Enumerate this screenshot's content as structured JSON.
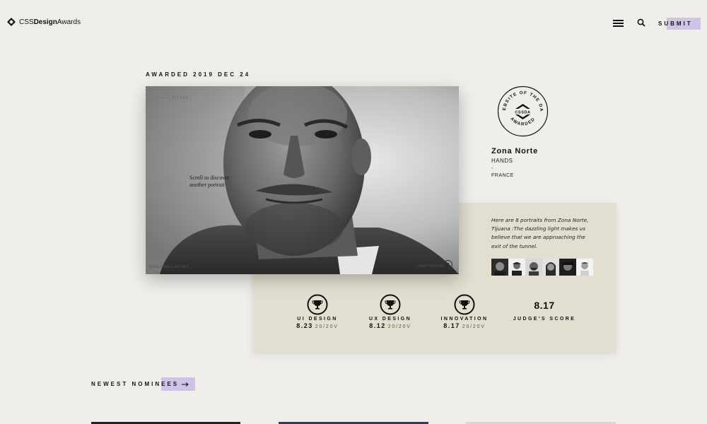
{
  "header": {
    "logo_text_light": "CSS",
    "logo_text_bold": "Design",
    "logo_text_end": "Awards",
    "menu_icon": "hamburger-icon",
    "search_icon": "search-icon",
    "submit_label": "SUBMIT"
  },
  "award": {
    "date_label": "AWARDED 2019 DEC 24"
  },
  "preview": {
    "return_label": "RETURN",
    "scroll_text": "Scroll to discover another portrait",
    "bottom_left": "SCROLL DOWN & DISCOVER",
    "bottom_right": "UNDER THE ROOM",
    "circle_glyph": "Z"
  },
  "badge": {
    "top_text": "WEBSITE OF THE DAY",
    "bottom_text": "AWARDED",
    "center_text": "CSSDA"
  },
  "site": {
    "title": "Zona Norte",
    "subtitle": "HANDS",
    "dash": "-",
    "country": "FRANCE",
    "description": "Here are 8 portraits from Zona Norte, Tijuana :The dazzling light makes us believe that we are approaching the exit of the tunnel."
  },
  "scores": [
    {
      "label": "UI DESIGN",
      "value": "8.23",
      "votes": "20/20V",
      "icon": "trophy-icon"
    },
    {
      "label": "UX DESIGN",
      "value": "8.12",
      "votes": "20/20V",
      "icon": "trophy-icon"
    },
    {
      "label": "INNOVATION",
      "value": "8.17",
      "votes": "20/20V",
      "icon": "trophy-icon"
    }
  ],
  "judge": {
    "value": "8.17",
    "label": "JUDGE'S SCORE"
  },
  "newest": {
    "label": "NEWEST NOMINEES"
  },
  "colors": {
    "background": "#efeeea",
    "panel": "#e2ded0",
    "highlight": "#cfc4e6",
    "text": "#111111"
  }
}
